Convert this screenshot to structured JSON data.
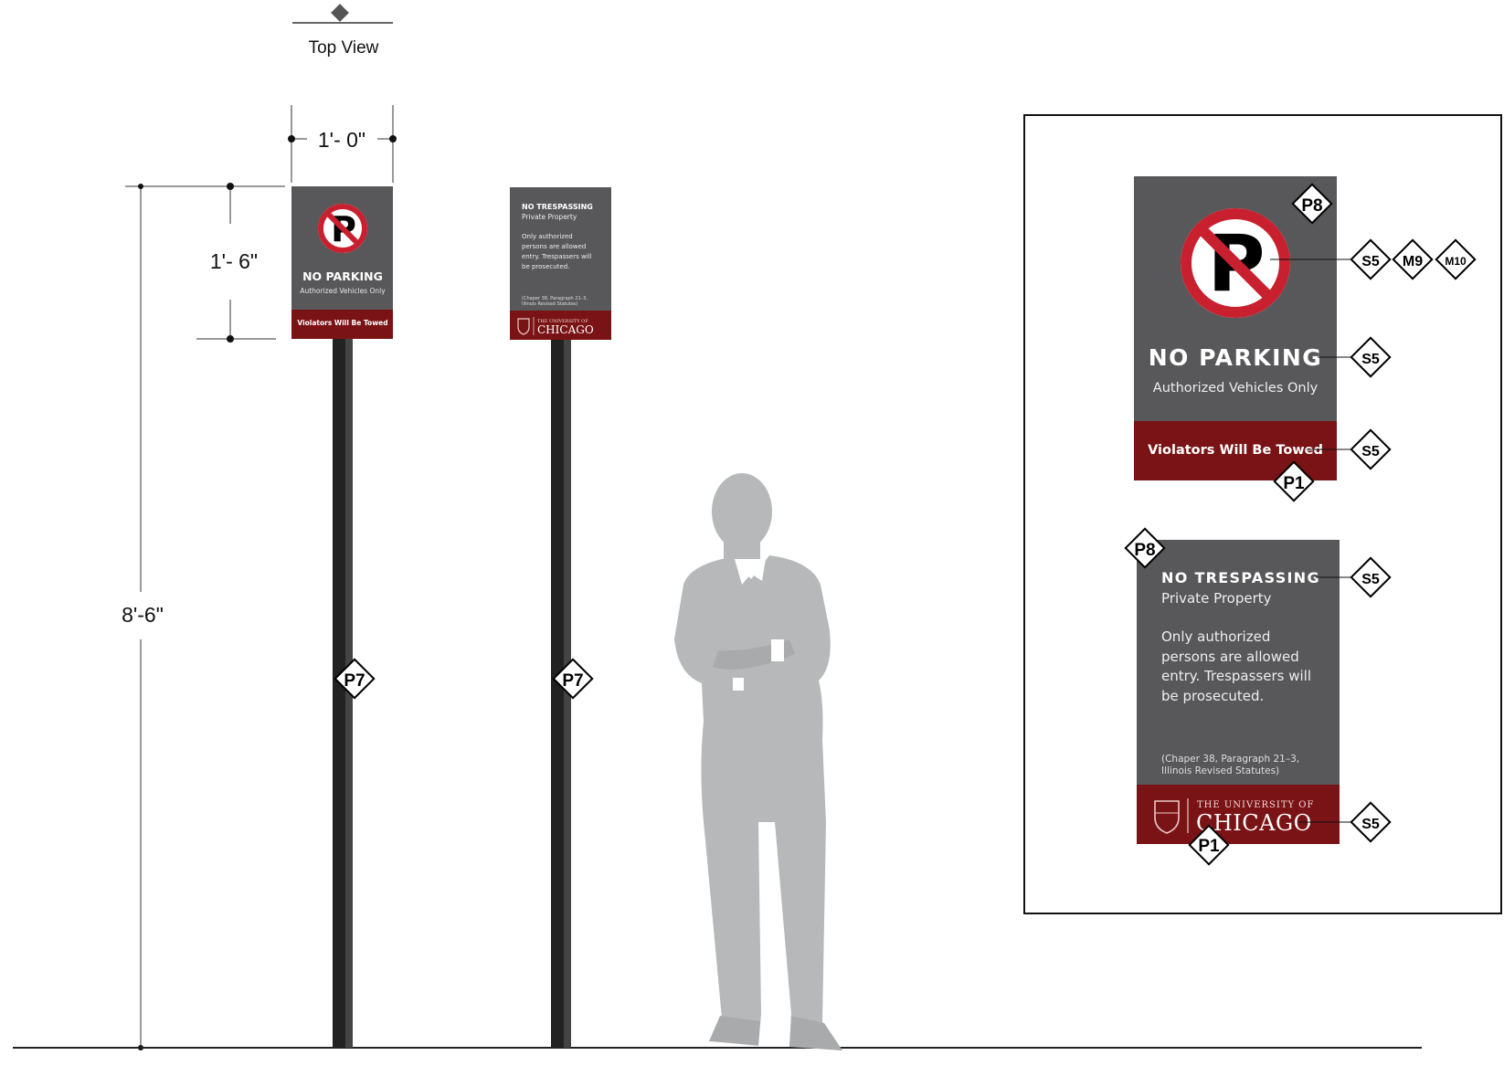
{
  "top_view": {
    "label": "Top View"
  },
  "dimensions": {
    "width": "1'- 0\"",
    "sign_height": "1'- 6\"",
    "overall_height": "8'-6\""
  },
  "parking_sign": {
    "title": "NO PARKING",
    "subtitle": "Authorized Vehicles Only",
    "footer": "Violators Will Be Towed"
  },
  "trespass_sign": {
    "title": "NO TRESPASSING",
    "subtitle": "Private Property",
    "body": [
      "Only authorized",
      "persons are allowed",
      "entry. Trespassers will",
      "be prosecuted."
    ],
    "citation": [
      "(Chaper 38, Paragraph 21–3,",
      "Illinois Revised Statutes)"
    ],
    "logo": {
      "line1": "THE UNIVERSITY OF",
      "line2": "CHICAGO"
    }
  },
  "callouts": {
    "post": "P7",
    "p8": "P8",
    "s5": "S5",
    "m9": "M9",
    "m10": "M10",
    "p1": "P1"
  },
  "colors": {
    "panel_gray": "#58585a",
    "maroon": "#7a1315",
    "sign_red": "#c8202f",
    "post_dark": "#222222",
    "figure_gray": "#b7b8ba"
  }
}
